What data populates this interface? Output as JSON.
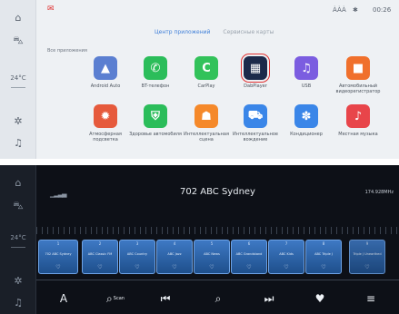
{
  "top": {
    "sidebar": {
      "icons": [
        "home-icon",
        "car-icon",
        "fan-icon",
        "phone-icon"
      ],
      "temperature": "24°C"
    },
    "status": {
      "network": "ÀÀÀ",
      "bluetooth": "✱",
      "time": "00:26"
    },
    "tabs": [
      {
        "label": "Центр приложений",
        "active": true
      },
      {
        "label": "Сервисные карты",
        "active": false
      }
    ],
    "section_label": "Все приложения",
    "apps": [
      {
        "label": "Android Auto",
        "icon": "android-auto-icon",
        "color": "#5b7fd1",
        "glyph": "▲"
      },
      {
        "label": "BT-телефон",
        "icon": "phone-icon",
        "color": "#2bbd5a",
        "glyph": "✆"
      },
      {
        "label": "CarPlay",
        "icon": "carplay-icon",
        "color": "#32c25a",
        "glyph": "C"
      },
      {
        "label": "DabPlayer",
        "icon": "dab-icon",
        "color": "#1c2a4a",
        "glyph": "▦"
      },
      {
        "label": "USB",
        "icon": "usb-icon",
        "color": "#7b5de0",
        "glyph": "♫"
      },
      {
        "label": "Автомобильный видеорегистратор",
        "icon": "dvr-icon",
        "color": "#f0702c",
        "glyph": "■"
      },
      {
        "label": "Атмосферная подсветка",
        "icon": "ambient-light-icon",
        "color": "#e65a3c",
        "glyph": "✹"
      },
      {
        "label": "Здоровье автомобиля",
        "icon": "car-health-icon",
        "color": "#2bbd5a",
        "glyph": "⛨"
      },
      {
        "label": "Интеллектуальная сцена",
        "icon": "smart-scene-icon",
        "color": "#f5892a",
        "glyph": "☗"
      },
      {
        "label": "Интеллектуальное вождение",
        "icon": "smart-driving-icon",
        "color": "#3a86e8",
        "glyph": "⛟"
      },
      {
        "label": "Кондиционер",
        "icon": "ac-icon",
        "color": "#3a86e8",
        "glyph": "✽"
      },
      {
        "label": "Местная музыка",
        "icon": "local-music-icon",
        "color": "#e8454a",
        "glyph": "♪"
      }
    ]
  },
  "bottom": {
    "sidebar": {
      "icons": [
        "home-icon",
        "car-icon",
        "fan-icon",
        "music-icon"
      ],
      "temperature": "24°C"
    },
    "station_title": "702 ABC Sydney",
    "frequency": "174.928MHz",
    "signal": "▁▂▃▄",
    "presets": [
      {
        "num": "1",
        "name": "702 ABC Sydney"
      },
      {
        "num": "2",
        "name": "ABC Classic FM"
      },
      {
        "num": "3",
        "name": "ABC Country"
      },
      {
        "num": "4",
        "name": "ABC Jazz"
      },
      {
        "num": "5",
        "name": "ABC News"
      },
      {
        "num": "6",
        "name": "ABC Grandstand"
      },
      {
        "num": "7",
        "name": "ABC Kids"
      },
      {
        "num": "8",
        "name": "ABC Triple J"
      },
      {
        "num": "9",
        "name": "Triple J Unearthed"
      }
    ],
    "controls": {
      "tune_label": "A",
      "scan_label": "Scan",
      "prev": "⏮",
      "search": "⌕",
      "next": "⏭",
      "favorite": "♥",
      "list": "≡"
    }
  }
}
